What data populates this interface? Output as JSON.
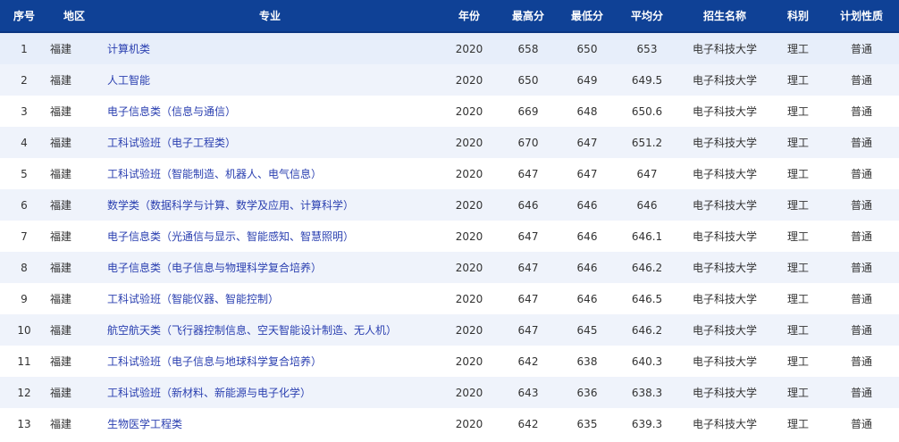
{
  "table": {
    "headers": [
      "序号",
      "地区",
      "专业",
      "年份",
      "最高分",
      "最低分",
      "平均分",
      "招生名称",
      "科别",
      "计划性质"
    ],
    "rows": [
      [
        "1",
        "福建",
        "计算机类",
        "2020",
        "658",
        "650",
        "653",
        "电子科技大学",
        "理工",
        "普通"
      ],
      [
        "2",
        "福建",
        "人工智能",
        "2020",
        "650",
        "649",
        "649.5",
        "电子科技大学",
        "理工",
        "普通"
      ],
      [
        "3",
        "福建",
        "电子信息类（信息与通信）",
        "2020",
        "669",
        "648",
        "650.6",
        "电子科技大学",
        "理工",
        "普通"
      ],
      [
        "4",
        "福建",
        "工科试验班（电子工程类）",
        "2020",
        "670",
        "647",
        "651.2",
        "电子科技大学",
        "理工",
        "普通"
      ],
      [
        "5",
        "福建",
        "工科试验班（智能制造、机器人、电气信息）",
        "2020",
        "647",
        "647",
        "647",
        "电子科技大学",
        "理工",
        "普通"
      ],
      [
        "6",
        "福建",
        "数学类（数据科学与计算、数学及应用、计算科学）",
        "2020",
        "646",
        "646",
        "646",
        "电子科技大学",
        "理工",
        "普通"
      ],
      [
        "7",
        "福建",
        "电子信息类（光通信与显示、智能感知、智慧照明）",
        "2020",
        "647",
        "646",
        "646.1",
        "电子科技大学",
        "理工",
        "普通"
      ],
      [
        "8",
        "福建",
        "电子信息类（电子信息与物理科学复合培养）",
        "2020",
        "647",
        "646",
        "646.2",
        "电子科技大学",
        "理工",
        "普通"
      ],
      [
        "9",
        "福建",
        "工科试验班（智能仪器、智能控制）",
        "2020",
        "647",
        "646",
        "646.5",
        "电子科技大学",
        "理工",
        "普通"
      ],
      [
        "10",
        "福建",
        "航空航天类（飞行器控制信息、空天智能设计制造、无人机）",
        "2020",
        "647",
        "645",
        "646.2",
        "电子科技大学",
        "理工",
        "普通"
      ],
      [
        "11",
        "福建",
        "工科试验班（电子信息与地球科学复合培养）",
        "2020",
        "642",
        "638",
        "640.3",
        "电子科技大学",
        "理工",
        "普通"
      ],
      [
        "12",
        "福建",
        "工科试验班（新材料、新能源与电子化学）",
        "2020",
        "643",
        "636",
        "638.3",
        "电子科技大学",
        "理工",
        "普通"
      ],
      [
        "13",
        "福建",
        "生物医学工程类",
        "2020",
        "642",
        "635",
        "639.3",
        "电子科技大学",
        "理工",
        "普通"
      ]
    ]
  }
}
